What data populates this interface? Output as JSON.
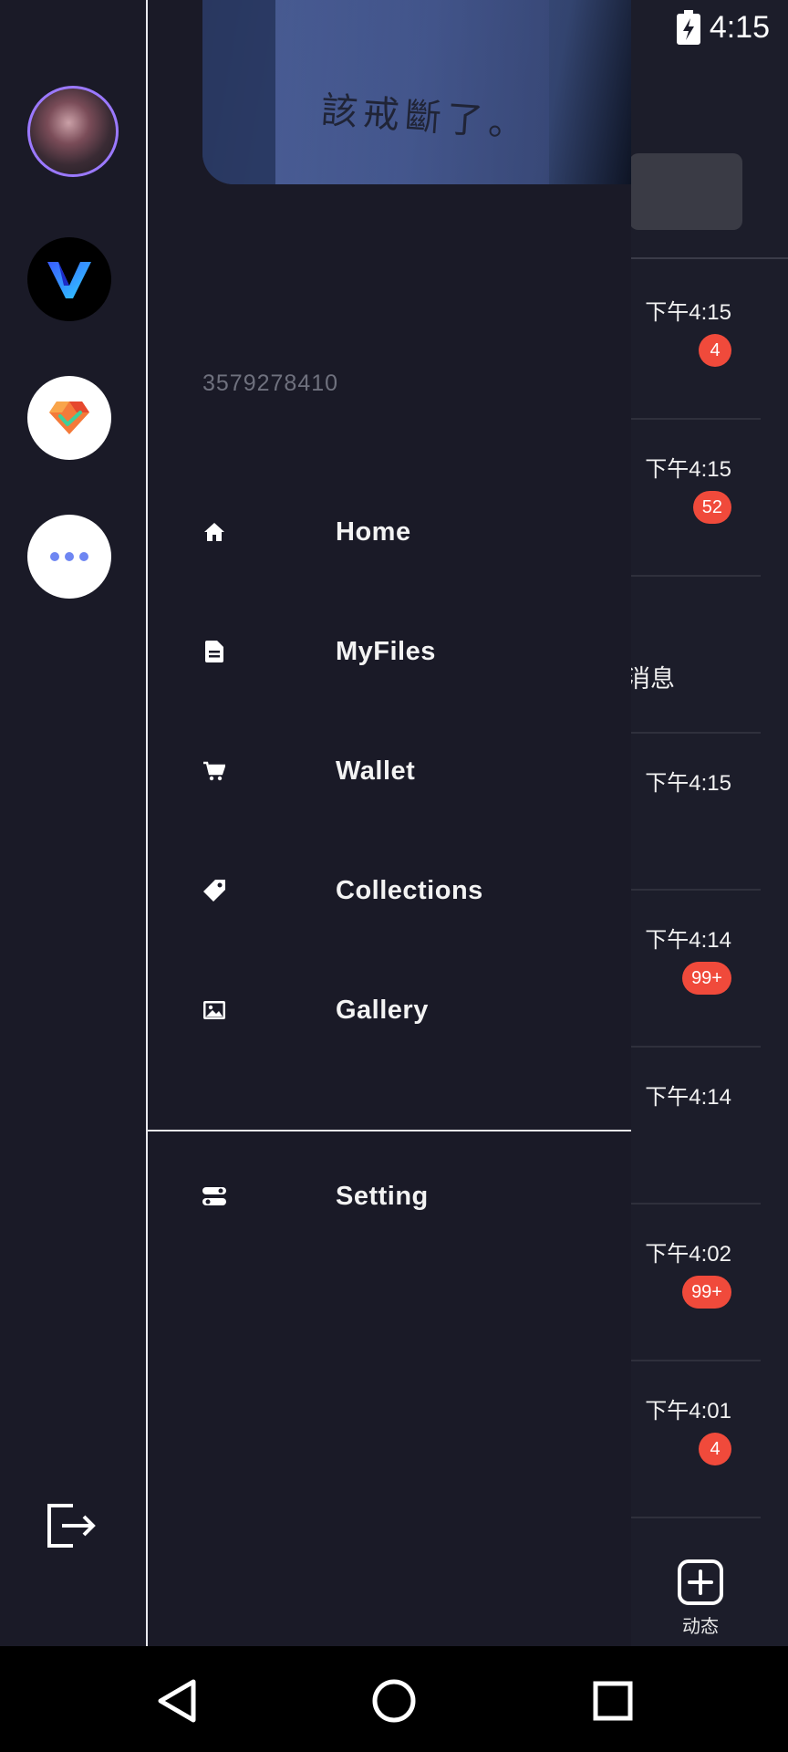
{
  "status_bar": {
    "time": "4:15"
  },
  "drawer": {
    "user_id": "3579278410",
    "cover_caption": "該戒斷了。",
    "menu": [
      {
        "label": "Home",
        "icon": "home-icon"
      },
      {
        "label": "MyFiles",
        "icon": "file-icon"
      },
      {
        "label": "Wallet",
        "icon": "cart-icon"
      },
      {
        "label": "Collections",
        "icon": "tag-icon"
      },
      {
        "label": "Gallery",
        "icon": "image-icon"
      }
    ],
    "setting": {
      "label": "Setting",
      "icon": "toggle-icon"
    }
  },
  "chats": [
    {
      "time": "下午4:15",
      "badge": "4"
    },
    {
      "time": "下午4:15",
      "badge": "52"
    },
    {
      "snippet": "消息"
    },
    {
      "time": "下午4:15"
    },
    {
      "time": "下午4:14",
      "badge": "99+"
    },
    {
      "time": "下午4:14"
    },
    {
      "time": "下午4:02",
      "badge": "99+"
    },
    {
      "time": "下午4:01",
      "badge": "4"
    }
  ],
  "moments": {
    "label": "动态"
  },
  "colors": {
    "badge": "#f04a3b",
    "background": "#1a1a27",
    "avatar_ring": "#9b79ff"
  }
}
